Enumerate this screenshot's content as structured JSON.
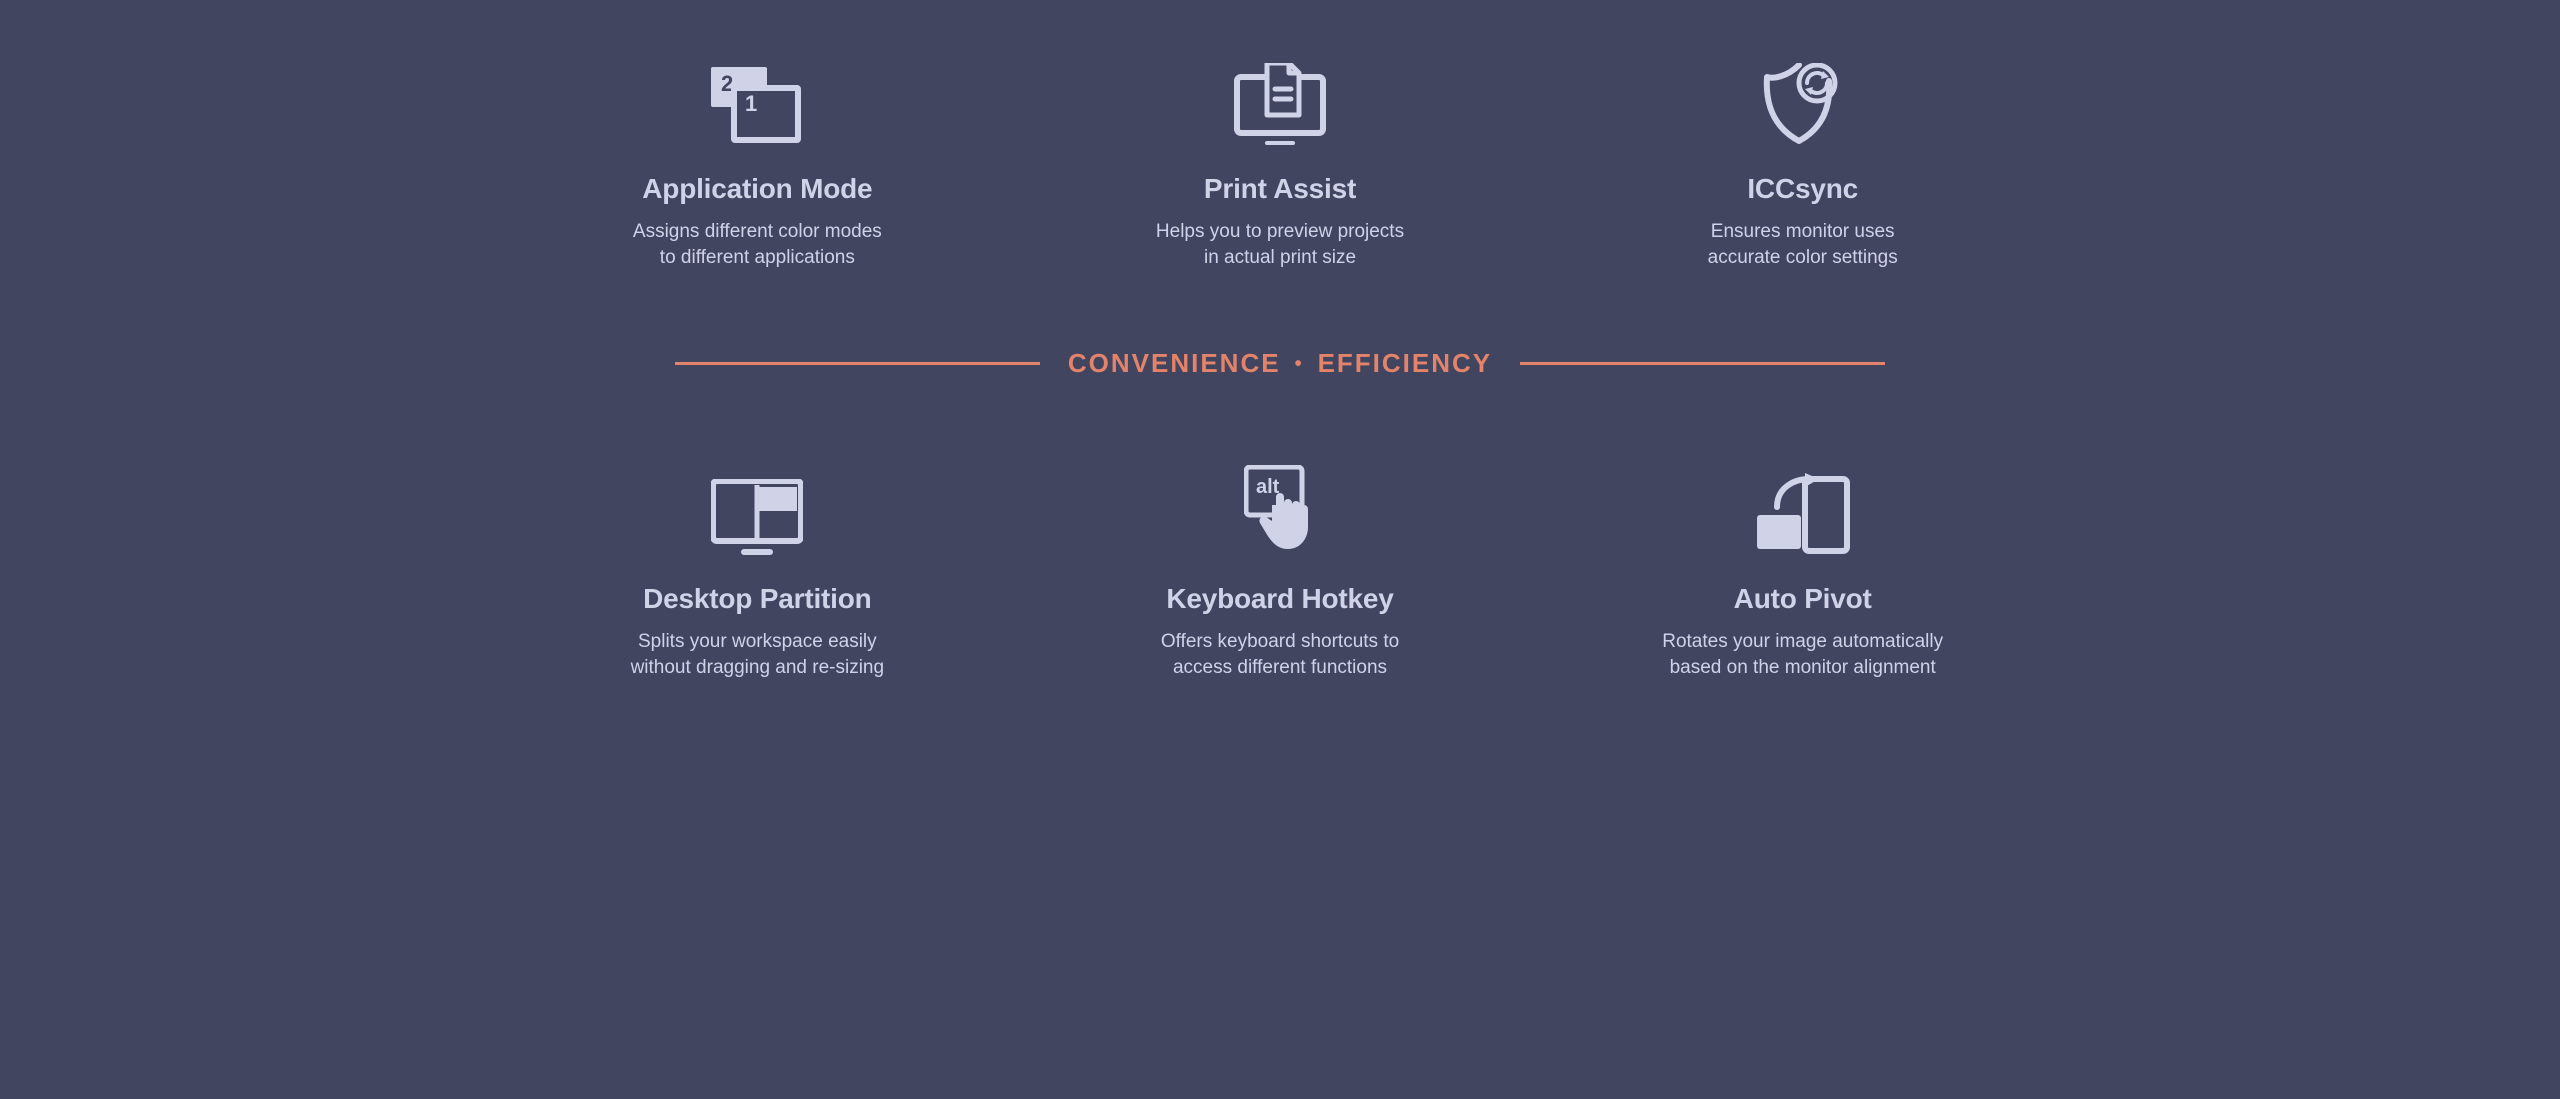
{
  "section1": {
    "items": [
      {
        "title": "Application Mode",
        "desc": "Assigns different color modes\nto different applications"
      },
      {
        "title": "Print Assist",
        "desc": "Helps you to preview projects\nin actual print size"
      },
      {
        "title": "ICCsync",
        "desc": "Ensures monitor uses\naccurate color settings"
      }
    ]
  },
  "divider": {
    "left": "CONVENIENCE",
    "right": "EFFICIENCY"
  },
  "section2": {
    "items": [
      {
        "title": "Desktop Partition",
        "desc": "Splits your workspace easily\nwithout dragging and re-sizing"
      },
      {
        "title": "Keyboard Hotkey",
        "desc": "Offers keyboard shortcuts to\naccess different functions"
      },
      {
        "title": "Auto Pivot",
        "desc": "Rotates your image automatically\nbased on the monitor alignment"
      }
    ]
  }
}
